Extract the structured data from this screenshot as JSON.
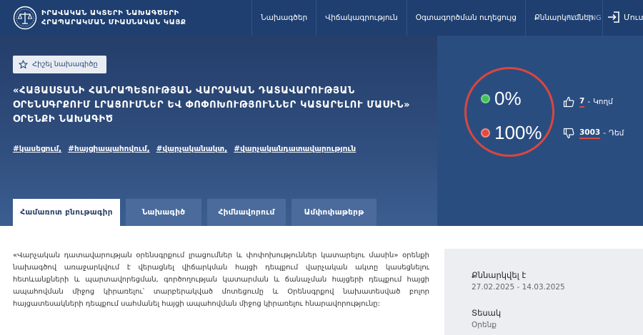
{
  "header": {
    "logo_line1": "ԻՐԱՎԱԿԱՆ ԱԿՏԵՐԻ ՆԱԽԱԳԾԵՐԻ",
    "logo_line2": "ՀՐԱՊԱՐԱԿՄԱՆ ՄԻԱՍՆԱԿԱՆ ԿԱՅՔ",
    "nav": [
      "Նախագծեր",
      "Վիճակագրություն",
      "Օգտագործման ուղեցույց",
      "Քննարկումներ"
    ],
    "lang_ru": "РУС",
    "lang_en": "ENG",
    "login": "Մուտք",
    "icons": {
      "logo": "scales-emblem-icon",
      "login": "sign-in-icon"
    }
  },
  "hero": {
    "favorite": "Հիշել նախագիծը",
    "title": "«ՀԱՅԱՍՏԱՆԻ ՀԱՆՐԱՊԵՏՈՒԹՅԱՆ ՎԱՐՉԱԿԱՆ ԴԱՏԱՎԱՐՈՒԹՅԱՆ ՕՐԵՆՍԳՐՔՈՒՄ ԼՐԱՑՈՒՄՆԵՐ ԵՎ ՓՈՓՈԽՈՒԹՅՈՒՆՆԵՐ ԿԱՏԱՐԵԼՈՒ ՄԱՍԻՆ» ՕՐԵՆՔԻ ՆԱԽԱԳԻԾ",
    "tags": [
      "#կասեցում,",
      "#հայցիապահովում,",
      "#վարչականակտ,",
      "#վարչականդատավարություն"
    ],
    "tabs": [
      "Համառոտ բնութագիր",
      "Նախագիծ",
      "Հիմնավորում",
      "Ամփոփաթերթ"
    ],
    "active_tab": 0
  },
  "vote": {
    "yes_percent": "0%",
    "no_percent": "100%",
    "yes_count": "7",
    "yes_label": "Կողմ",
    "no_count": "3003",
    "no_label": "Դեմ",
    "dash": "-",
    "colors": {
      "panel": "#2a4d80",
      "ring": "#d9473f",
      "yes": "#3fc25a",
      "no": "#e04a3f"
    }
  },
  "content": {
    "description": "«Վարչական դատավարության օրենսգրքում լրացումներ և փոփոխություններ կատարելու մասին» օրենքի նախագծով առաջարկվում է վերացնել վիճարկման հայցի դեպքում վարչական ակտը կասեցնելու հետևանքների և պարտավորեցման, գործողության կատարման և ճանաչման հայցերի դեպքում հայցի ապահովման միջոց կիրառելու՝ տարբերակված մոտեցումը և Օրենսգրքով նախատեսված բոլոր հայցատեսակների դեպքում սահմանել հայցի ապահովման միջոց կիրառելու հնարավորությունը:"
  },
  "sidebar": {
    "discussed_label": "Քննարկվել է",
    "discussed_value": "27.02.2025 - 14.03.2025",
    "type_label": "Տեսակ",
    "type_value": "Օրենք"
  }
}
